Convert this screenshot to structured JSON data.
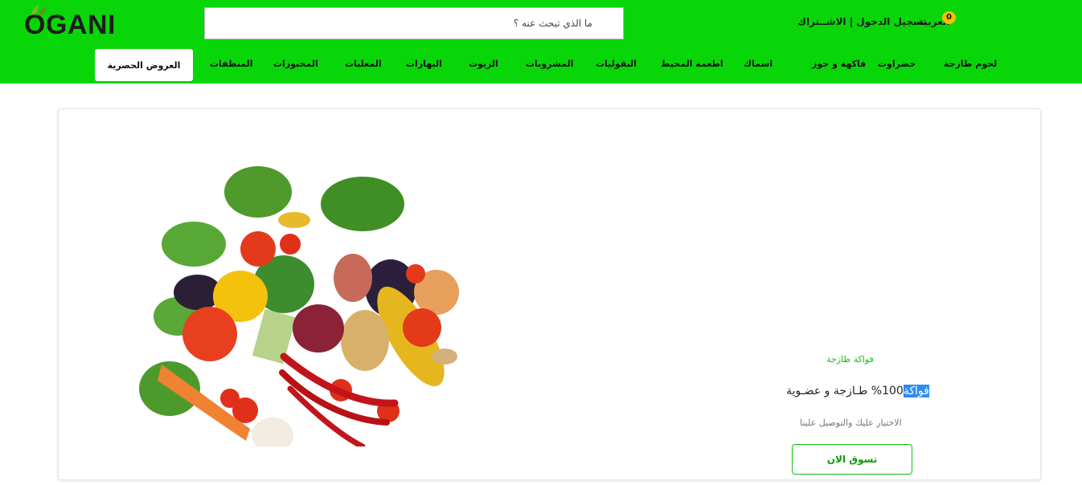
{
  "brand": {
    "logo_text": "OGANI",
    "green": "#09d609",
    "leaf_icon": "leaf-icon"
  },
  "search": {
    "placeholder": "ما الذي تبحث عنه ؟"
  },
  "header": {
    "language_label": "العربية",
    "auth_label": "تسجيل الدخول | الاشــتراك",
    "cart_count": "0"
  },
  "nav": {
    "items": [
      "لحوم طازجة",
      "خضراوت",
      "فاكهة و جوز",
      "اسماك",
      "اطعمة المحيط",
      "البقوليات",
      "المشروبات",
      "الزيوت",
      "البهارات",
      "المعلبات",
      "المخبوزات",
      "المنظفات"
    ],
    "active_label": "العروض الحصرية"
  },
  "hero": {
    "eyebrow": "فواكة طازجة",
    "headline_highlight": "فواكة",
    "headline_rest": "100% طـازجة و عضـوية",
    "subtitle": "الاختيار عليك والتوصيل علينا",
    "cta_label": "تسوق الان",
    "image_alt": "vegetables-image"
  }
}
